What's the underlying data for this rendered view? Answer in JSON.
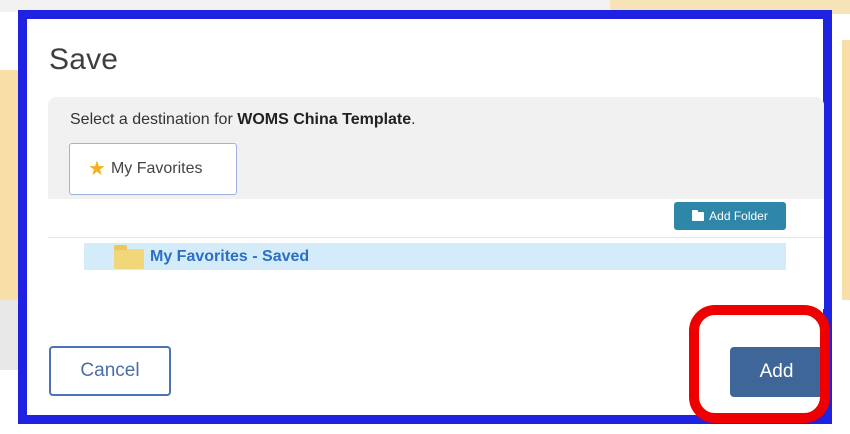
{
  "dialog": {
    "title": "Save",
    "destination_prefix": "Select a destination for ",
    "template_name": "WOMS China Template",
    "destination_suffix": ".",
    "favorites_tab": {
      "icon": "star-icon",
      "label": "My Favorites"
    },
    "add_folder_button": {
      "icon": "folder-icon",
      "label": "Add Folder"
    },
    "tree": {
      "items": [
        {
          "icon": "folder-icon",
          "label": "My Favorites - Saved",
          "selected": true
        }
      ]
    },
    "cancel_label": "Cancel",
    "add_label": "Add"
  },
  "colors": {
    "highlight_frame": "#1f22e0",
    "annotation_ring": "#ee0000",
    "primary_button": "#3f6699",
    "add_folder_button": "#2e86a8",
    "selected_row": "#d4ecf9",
    "link_text": "#2c6fc4"
  }
}
